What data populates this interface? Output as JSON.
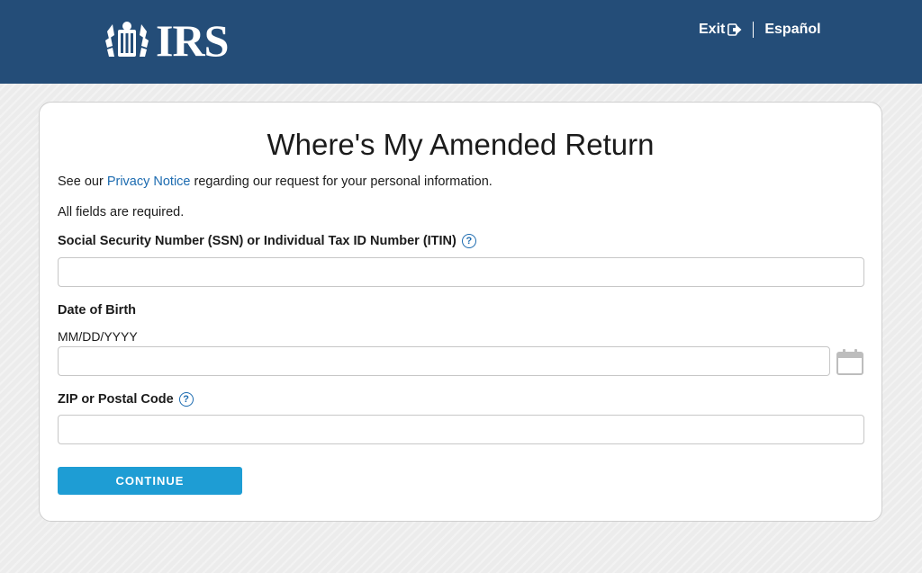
{
  "header": {
    "logo_text": "IRS",
    "exit_label": "Exit",
    "language_label": "Español"
  },
  "form": {
    "title": "Where's My Amended Return",
    "privacy_prefix": "See our ",
    "privacy_link": "Privacy Notice",
    "privacy_suffix": " regarding our request for your personal information.",
    "required_note": "All fields are required.",
    "ssn_label": "Social Security Number (SSN) or Individual Tax ID Number (ITIN)",
    "ssn_value": "",
    "dob_label": "Date of Birth",
    "dob_hint": "MM/DD/YYYY",
    "dob_value": "",
    "zip_label": "ZIP or Postal Code",
    "zip_value": "",
    "help_glyph": "?",
    "continue_label": "CONTINUE"
  },
  "icons": {
    "logo": "irs-eagle-logo-icon",
    "exit": "exit-arrow-icon",
    "help": "question-circle-icon",
    "calendar": "calendar-icon"
  },
  "colors": {
    "header_bg": "#244d78",
    "link": "#1c6bb0",
    "button_bg": "#1e9dd4"
  }
}
